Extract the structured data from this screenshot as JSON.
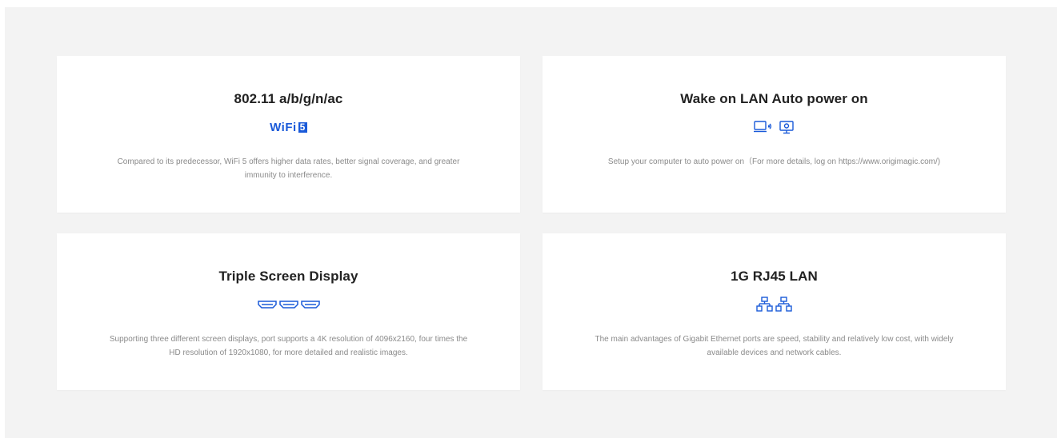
{
  "cards": [
    {
      "title": "802.11 a/b/g/n/ac",
      "icon_name": "wifi5-logo-icon",
      "icon_text_main": "WiFi",
      "icon_text_badge": "5",
      "description": "Compared to its predecessor, WiFi 5 offers higher data rates, better signal coverage, and greater immunity to interference."
    },
    {
      "title": "Wake on LAN  Auto power on",
      "icon_name": "wake-on-lan-icon",
      "description": "Setup your computer to auto power on（For more details, log on https://www.origimagic.com/)"
    },
    {
      "title": "Triple Screen Display",
      "icon_name": "hdmi-ports-icon",
      "description": "Supporting three different screen displays, port supports a 4K resolution of 4096x2160, four times the HD resolution of 1920x1080, for more detailed and realistic images."
    },
    {
      "title": "1G RJ45 LAN",
      "icon_name": "ethernet-network-icon",
      "description": "The main advantages of Gigabit Ethernet ports are speed, stability and relatively low cost, with widely available devices and network cables."
    }
  ],
  "colors": {
    "accent": "#1a5ad9",
    "background": "#f3f3f3",
    "card": "#ffffff",
    "title": "#222222",
    "body": "#8a8a8a"
  }
}
